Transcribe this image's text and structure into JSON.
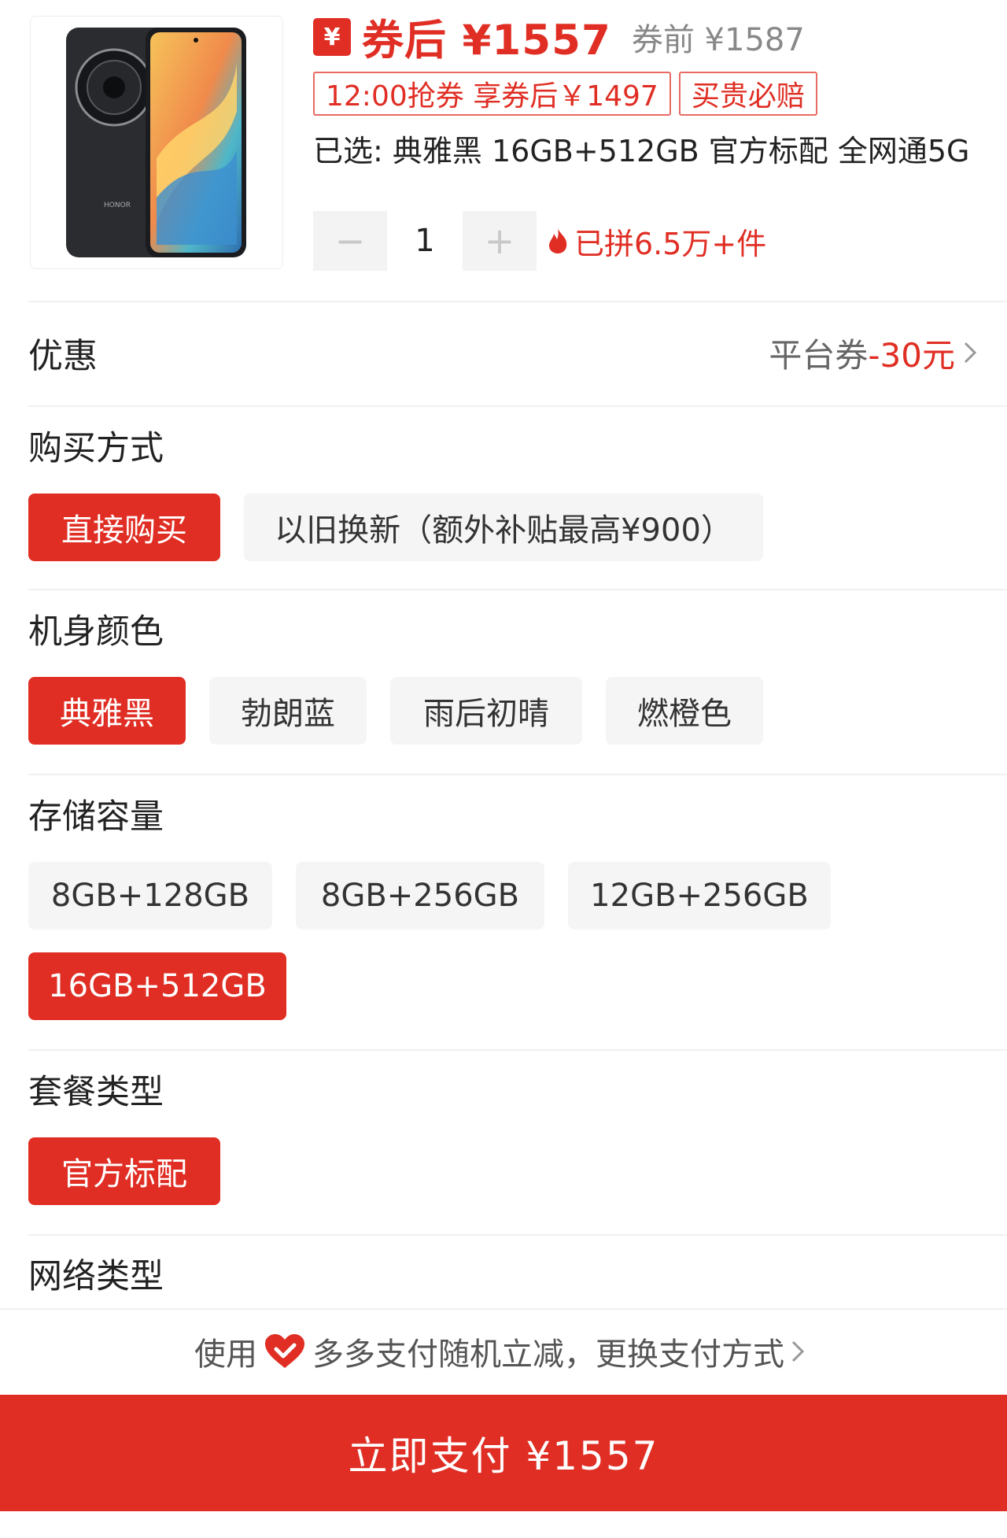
{
  "product": {
    "image_alt": "HONOR",
    "coupon_icon": "¥",
    "price_after": "券后 ¥1557",
    "price_before": "券前 ¥1587",
    "tags": [
      "12:00抢券 享券后￥1497",
      "买贵必赔"
    ],
    "selected": "已选: 典雅黑 16GB+512GB 官方标配 全网通5G",
    "quantity": {
      "minus": "−",
      "value": "1",
      "plus": "+"
    },
    "sold": "已拼6.5万+件",
    "brand_on_phone": "HONOR"
  },
  "discount": {
    "label": "优惠",
    "prefix": "平台券",
    "amount": "-30元"
  },
  "purchase_mode": {
    "title": "购买方式",
    "options": [
      "直接购买",
      "以旧换新（额外补贴最高¥900）"
    ],
    "selected": 0
  },
  "color": {
    "title": "机身颜色",
    "options": [
      "典雅黑",
      "勃朗蓝",
      "雨后初晴",
      "燃橙色"
    ],
    "selected": 0
  },
  "storage": {
    "title": "存储容量",
    "options": [
      "8GB+128GB",
      "8GB+256GB",
      "12GB+256GB",
      "16GB+512GB"
    ],
    "selected": 3
  },
  "package": {
    "title": "套餐类型",
    "options": [
      "官方标配"
    ],
    "selected": 0
  },
  "network": {
    "title": "网络类型"
  },
  "payment": {
    "hint_prefix": "使用",
    "hint_text": "多多支付随机立减，更换支付方式",
    "button": "立即支付 ¥1557"
  },
  "colors": {
    "accent": "#e02e24",
    "chip_bg": "#f5f5f5"
  }
}
